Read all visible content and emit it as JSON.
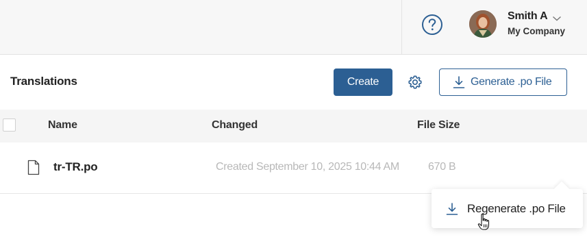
{
  "header": {
    "help_icon": "question-circle-icon",
    "user_name": "Smith A",
    "company": "My Company"
  },
  "page": {
    "title": "Translations",
    "create_label": "Create",
    "settings_icon": "gear-icon",
    "generate_label": "Generate .po File"
  },
  "table": {
    "columns": [
      "Name",
      "Changed",
      "File Size"
    ],
    "rows": [
      {
        "name": "tr-TR.po",
        "changed": "Created September 10, 2025 10:44 AM",
        "size": "670 B"
      }
    ]
  },
  "context_menu": {
    "items": [
      {
        "label": "Regenerate .po File",
        "icon": "download-icon"
      }
    ]
  },
  "colors": {
    "accent": "#2c5f93",
    "muted_text": "#b8b8b8",
    "header_bg": "#f7f7f7"
  }
}
